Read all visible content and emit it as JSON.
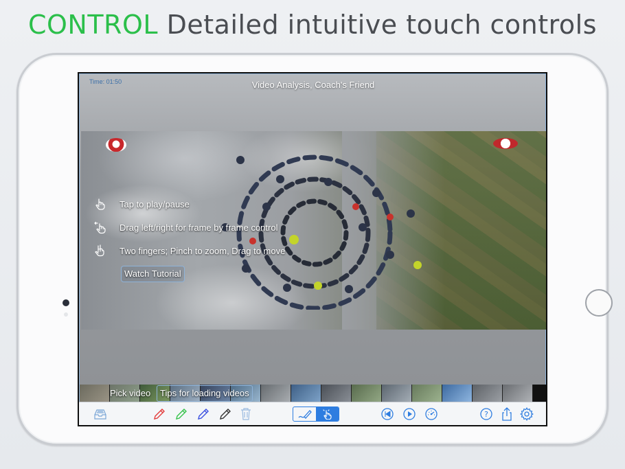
{
  "headline": {
    "accent": "CONTROL",
    "text": "Detailed intuitive touch controls"
  },
  "app": {
    "time": "Time: 01:50",
    "title": "Video Analysis, Coach's Friend"
  },
  "tips": [
    {
      "icon": "tap-hand-icon",
      "text": "Tap to play/pause"
    },
    {
      "icon": "drag-hand-icon",
      "text": "Drag left/right for frame by frame control"
    },
    {
      "icon": "pinch-hand-icon",
      "text": "Two fingers; Pinch to zoom, Drag to move"
    }
  ],
  "watch_tutorial": "Watch Tutorial",
  "filmstrip": {
    "pick_video": "Pick video",
    "tips_loading": "Tips for loading videos"
  },
  "toolbar": {
    "icons": [
      "inbox-tray-icon",
      "pencil-red-icon",
      "pencil-green-icon",
      "pencil-blue-icon",
      "pencil-black-icon",
      "trash-icon",
      "draw-mode-icon",
      "touch-mode-icon",
      "skip-back-icon",
      "play-icon",
      "speed-dial-icon",
      "help-icon",
      "share-icon",
      "settings-gear-icon"
    ],
    "active_mode": "touch"
  },
  "colors": {
    "accent_green": "#2bbf4a",
    "ios_blue": "#2e7de0",
    "pen_red": "#e23b3b",
    "pen_green": "#35c24a",
    "pen_blue": "#3a4fe0",
    "pen_black": "#333333"
  }
}
